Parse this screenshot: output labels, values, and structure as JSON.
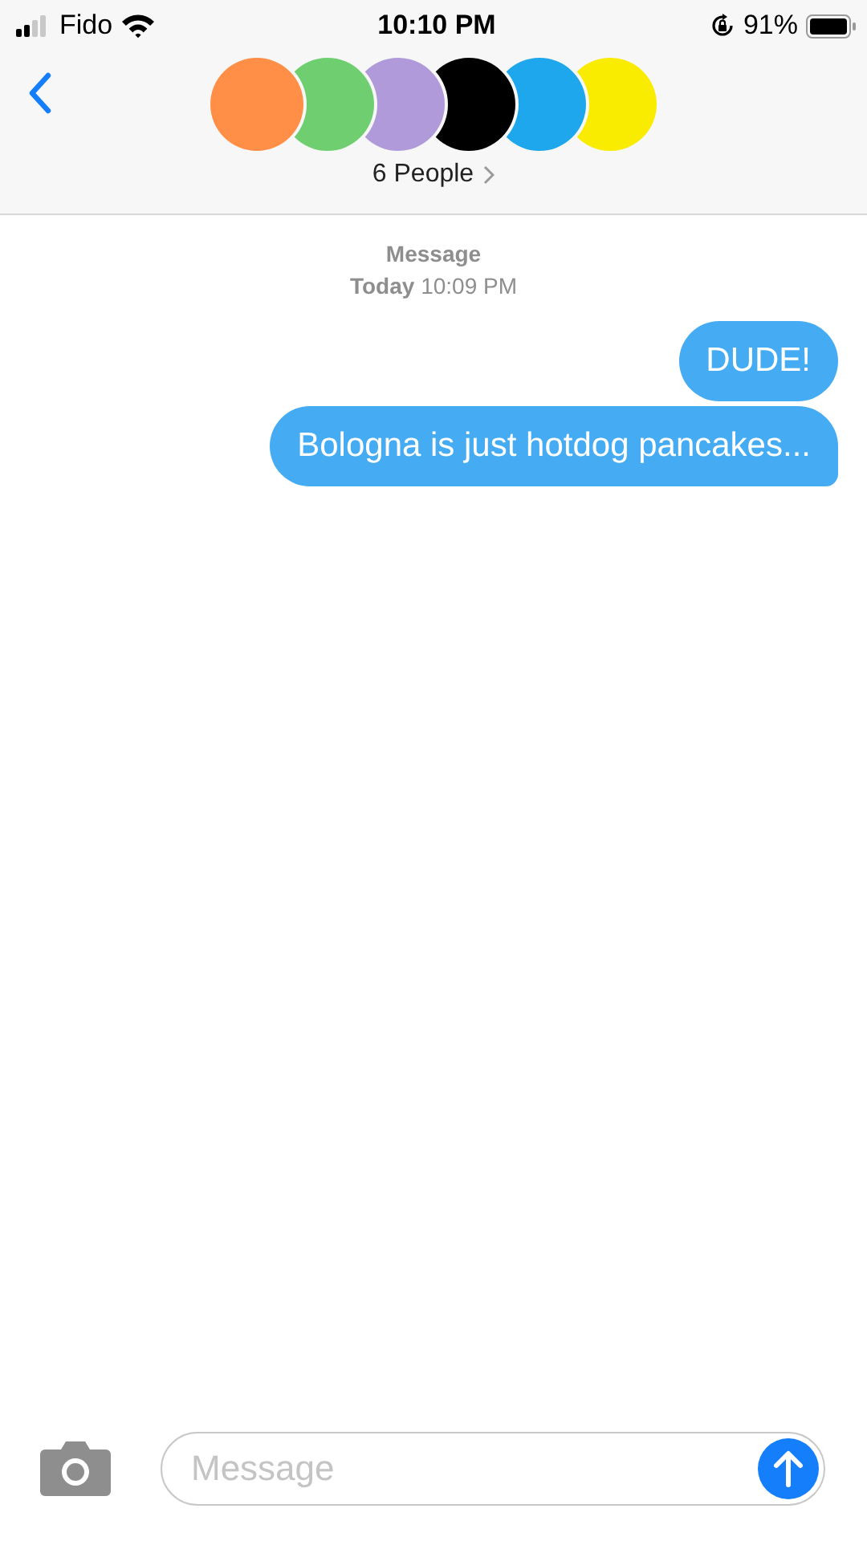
{
  "status_bar": {
    "carrier": "Fido",
    "time": "10:10 PM",
    "battery": "91%"
  },
  "header": {
    "avatars": [
      {
        "color": "#ff8e47"
      },
      {
        "color": "#6fcf70"
      },
      {
        "color": "#b09ad9"
      },
      {
        "color": "#000000"
      },
      {
        "color": "#1ea7ec"
      },
      {
        "color": "#f9ec00"
      }
    ],
    "title": "6 People"
  },
  "thread": {
    "service": "Message",
    "timestamp": "**Today** 10:09 PM",
    "messages": [
      {
        "text": "DUDE!",
        "tail": false
      },
      {
        "text": "Bologna is just hotdog pancakes...",
        "tail": true
      }
    ]
  },
  "composer": {
    "placeholder": "Message"
  }
}
